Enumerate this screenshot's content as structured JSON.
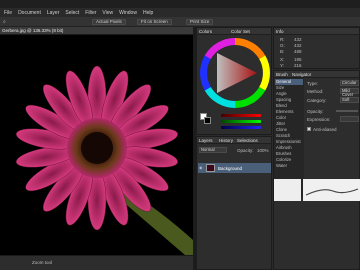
{
  "menu": [
    "File",
    "Document",
    "Layer",
    "Select",
    "Filter",
    "View",
    "Window",
    "Help"
  ],
  "toolbar": {
    "actual_pixels": "Actual Pixels",
    "fit_on_screen": "Fit on Screen",
    "print_size": "Print Size"
  },
  "document_tab": {
    "title": "Gerbera.jpg @ 136.33% (8 bit)"
  },
  "status": {
    "left": "",
    "right": "Zoom tool"
  },
  "color_panel": {
    "tabs": [
      "Colors",
      "Color Set"
    ],
    "hue_wheel": "color-wheel",
    "fg_color": "#ffffff",
    "bg_color": "#000000",
    "r": "255",
    "g": "255",
    "b": "255"
  },
  "layers_panel": {
    "tabs": [
      "Layers",
      "History",
      "Selections"
    ],
    "mode": "Normal",
    "opacity_label": "Opacity:",
    "opacity_value": "100%",
    "layer_name": "Background"
  },
  "info_panel": {
    "title": "Info",
    "labels": [
      "R:",
      "G:",
      "B:",
      "X:",
      "Y:"
    ],
    "values": [
      "432",
      "432",
      "488",
      "195",
      "216"
    ]
  },
  "brush_panel": {
    "tabs": [
      "Brush",
      "Navigator"
    ],
    "categories": [
      "General",
      "Size",
      "Angle",
      "Spacing",
      "Blend",
      "Elements",
      "Color",
      "Jitter",
      "Clone",
      "Scratch",
      "Impressionist",
      "Airbrush",
      "Brushes",
      "Colorize",
      "Water"
    ],
    "selected": "General",
    "props": [
      {
        "label": "Type:",
        "value": "Circular"
      },
      {
        "label": "Method:",
        "value": "Mild Cover"
      },
      {
        "label": "Category:",
        "value": "Soft"
      },
      {
        "label": "Opacity:",
        "value": ""
      },
      {
        "label": "Expression:",
        "value": ""
      }
    ],
    "antialiased": "Anti-aliased"
  },
  "colors": {
    "accent": "#4a5f7a",
    "petal": "#c2266a"
  }
}
